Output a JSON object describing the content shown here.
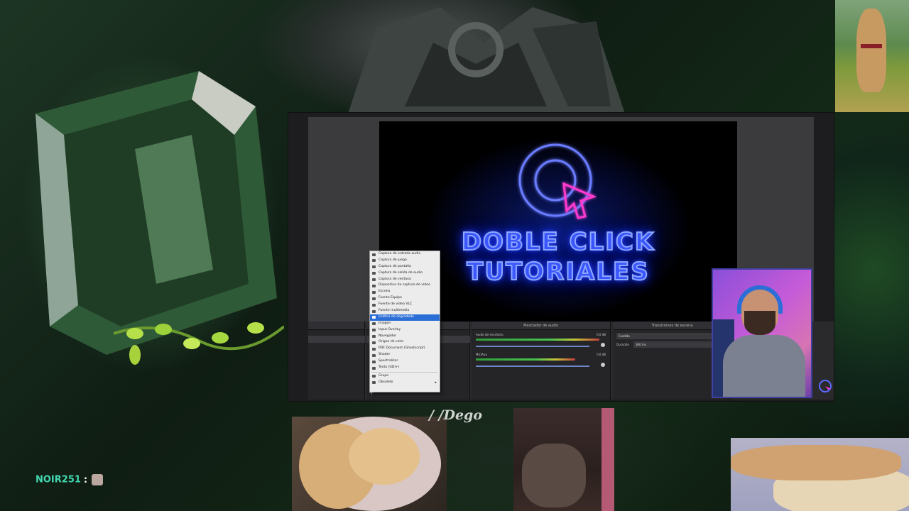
{
  "stream": {
    "chat_user": "NOIR251",
    "chat_separator": ":",
    "signature": "/ /Dego"
  },
  "preview": {
    "title_line1": "DOBLE CLICK",
    "title_line2": "TUTORIALES",
    "accent": "#3a56ff",
    "pointer_color": "#ff3ad0"
  },
  "obs": {
    "mixer_title": "Mezclador de audio",
    "transitions_title": "Transiciones de escena",
    "transition_value": "Fundido",
    "duration_label": "Duración",
    "duration_value": "300 ms",
    "channels": [
      {
        "name": "Audio del escritorio",
        "db": "0.0 dB"
      },
      {
        "name": "Mic/Aux",
        "db": "0.0 dB"
      }
    ]
  },
  "context_menu": {
    "items": [
      {
        "label": "Captura de entrada audio",
        "icon": "mic-icon"
      },
      {
        "label": "Captura de juego",
        "icon": "gamepad-icon"
      },
      {
        "label": "Captura de pantalla",
        "icon": "monitor-icon"
      },
      {
        "label": "Captura de salida de audio",
        "icon": "speaker-icon"
      },
      {
        "label": "Captura de ventana",
        "icon": "window-icon"
      },
      {
        "label": "Dispositivo de captura de vídeo",
        "icon": "camera-icon"
      },
      {
        "label": "Escena",
        "icon": "scene-icon"
      },
      {
        "label": "Fuente Equipo",
        "icon": "browser-icon"
      },
      {
        "label": "Fuente de vídeo VLC",
        "icon": "play-icon"
      },
      {
        "label": "Fuente multimedia",
        "icon": "media-icon"
      },
      {
        "label": "Gráfico de degradado",
        "icon": "gradient-icon",
        "selected": true
      },
      {
        "label": "Imagen",
        "icon": "image-icon"
      },
      {
        "label": "Input Overlay",
        "icon": "keyboard-icon"
      },
      {
        "label": "Navegador",
        "icon": "globe-icon"
      },
      {
        "label": "Origen de color",
        "icon": "brush-icon"
      },
      {
        "label": "PDF Document (Ghostscript)",
        "icon": "pdf-icon"
      },
      {
        "label": "Shader",
        "icon": "shader-icon"
      },
      {
        "label": "Spectralizer",
        "icon": "spectrum-icon"
      },
      {
        "label": "Texto (GDI+)",
        "icon": "text-icon"
      },
      {
        "label": "Grupo",
        "icon": "folder-icon"
      },
      {
        "label": "Obsoleto",
        "icon": "archive-icon",
        "submenu": true
      }
    ]
  }
}
